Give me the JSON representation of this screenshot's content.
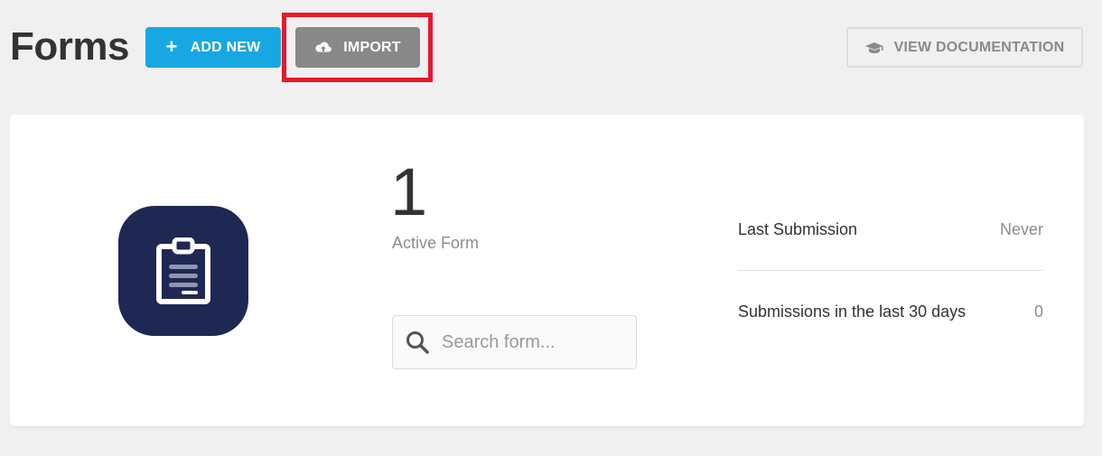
{
  "header": {
    "title": "Forms",
    "add_new_label": "ADD NEW",
    "import_label": "IMPORT",
    "docs_label": "VIEW DOCUMENTATION"
  },
  "summary": {
    "active_count": "1",
    "active_label": "Active Form",
    "search_placeholder": "Search form...",
    "stats": [
      {
        "label": "Last Submission",
        "value": "Never"
      },
      {
        "label": "Submissions in the last 30 days",
        "value": "0"
      }
    ]
  },
  "icons": {
    "add": "plus-icon",
    "import": "cloud-upload-icon",
    "docs": "graduation-cap-icon",
    "forms": "clipboard-icon",
    "search": "search-icon"
  },
  "colors": {
    "primary": "#17a8e3",
    "import_button": "#888888",
    "highlight": "#e8172b",
    "icon_bg": "#1f2853"
  }
}
